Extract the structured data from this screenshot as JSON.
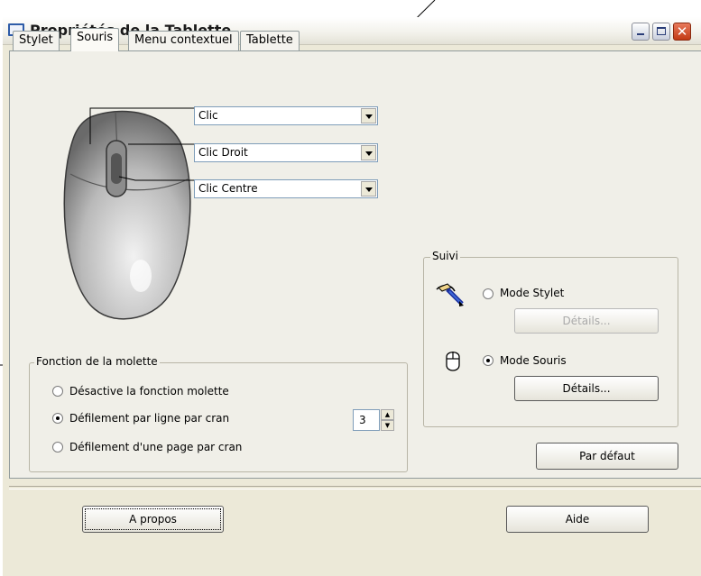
{
  "window": {
    "title": "Propriétés de la Tablette"
  },
  "tabs": [
    {
      "label": "Stylet"
    },
    {
      "label": "Souris"
    },
    {
      "label": "Menu contextuel"
    },
    {
      "label": "Tablette"
    }
  ],
  "active_tab": "Souris",
  "buttons_map": [
    {
      "value": "Clic"
    },
    {
      "value": "Clic Droit"
    },
    {
      "value": "Clic Centre"
    }
  ],
  "wheel": {
    "legend": "Fonction de la molette",
    "options": [
      {
        "label": "Désactive la fonction molette",
        "checked": false
      },
      {
        "label": "Défilement par ligne par cran",
        "checked": true
      },
      {
        "label": "Défilement d'une page par cran",
        "checked": false
      }
    ],
    "lines_value": "3"
  },
  "tracking": {
    "legend": "Suivi",
    "pen_mode": {
      "label": "Mode Stylet",
      "checked": false,
      "details_label": "Détails...",
      "details_enabled": false
    },
    "mouse_mode": {
      "label": "Mode Souris",
      "checked": true,
      "details_label": "Détails...",
      "details_enabled": true
    }
  },
  "footer": {
    "default_label": "Par défaut",
    "about_label": "A propos",
    "help_label": "Aide"
  }
}
